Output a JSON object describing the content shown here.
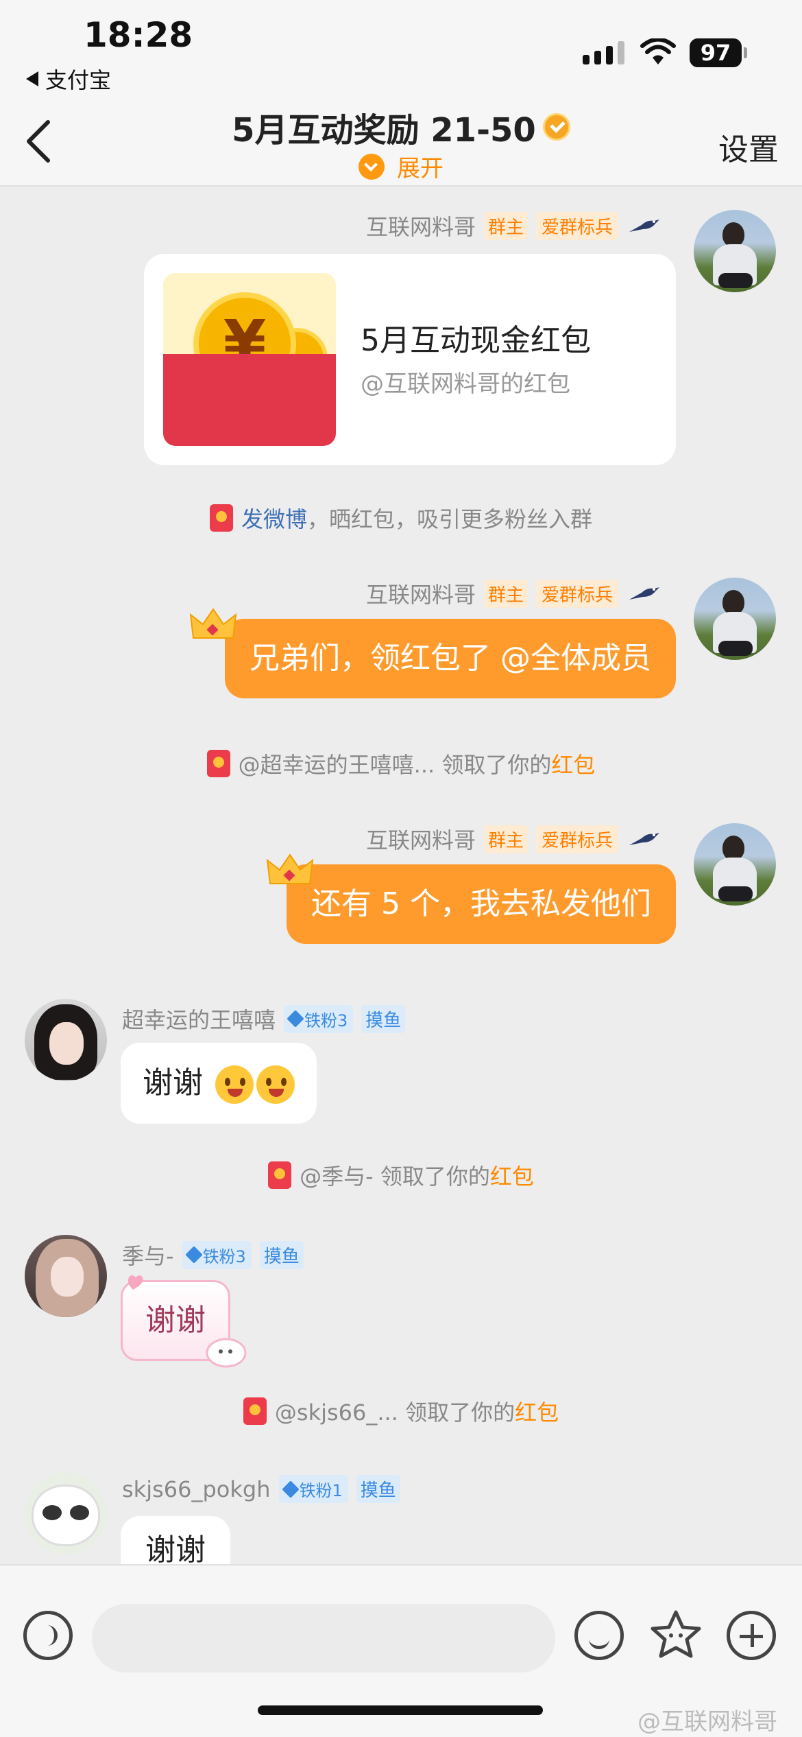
{
  "status_bar": {
    "time": "18:28",
    "back_app": "支付宝",
    "battery": "97"
  },
  "header": {
    "title": "5月互动奖励 21-50",
    "expand": "展开",
    "settings": "设置"
  },
  "messages": {
    "m1": {
      "sender": "互联网料哥",
      "tag_owner": "群主",
      "tag_love": "爱群标兵",
      "card_title": "5月互动现金红包",
      "card_sub": "@互联网料哥的红包"
    },
    "sys1": {
      "link": "发微博",
      "text": "，晒红包，吸引更多粉丝入群"
    },
    "m2": {
      "sender": "互联网料哥",
      "tag_owner": "群主",
      "tag_love": "爱群标兵",
      "text": "兄弟们，领红包了 @全体成员"
    },
    "sys2": {
      "text": "@超幸运的王嘻嘻... 领取了你的",
      "link": "红包"
    },
    "m3": {
      "sender": "互联网料哥",
      "tag_owner": "群主",
      "tag_love": "爱群标兵",
      "text": "还有 5 个，我去私发他们"
    },
    "m4": {
      "sender": "超幸运的王嘻嘻",
      "fan": "铁粉3",
      "fish": "摸鱼",
      "text": "谢谢"
    },
    "sys3": {
      "text": "@季与- 领取了你的",
      "link": "红包"
    },
    "m5": {
      "sender": "季与-",
      "fan": "铁粉3",
      "fish": "摸鱼",
      "text": "谢谢"
    },
    "sys4": {
      "text": "@skjs66_... 领取了你的",
      "link": "红包"
    },
    "m6": {
      "sender": "skjs66_pokgh",
      "fan": "铁粉1",
      "fish": "摸鱼",
      "text": "谢谢"
    }
  },
  "watermark": "@互联网料哥",
  "colors": {
    "accent": "#ff9b2c",
    "link": "#3d6fb6",
    "fan_tag": "#3a8be0"
  }
}
